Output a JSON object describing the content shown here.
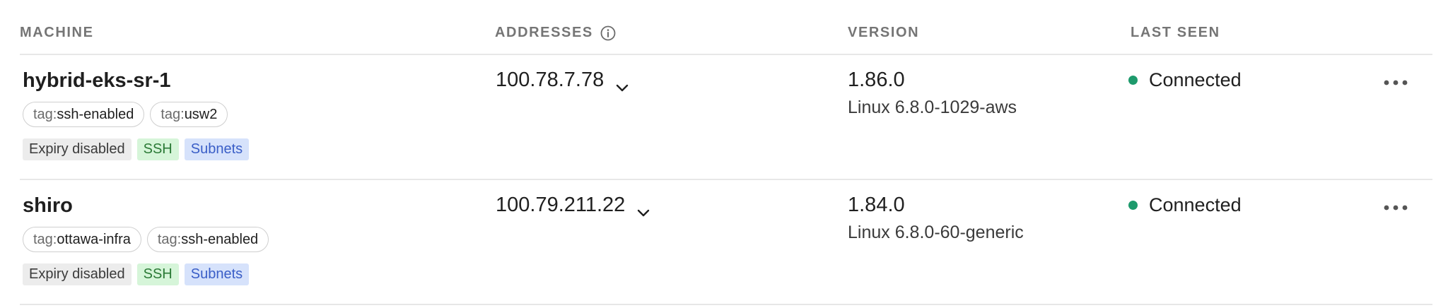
{
  "header": {
    "machine": "MACHINE",
    "addresses": "ADDRESSES",
    "version": "VERSION",
    "last_seen": "LAST SEEN"
  },
  "icons": {
    "info": "info-icon",
    "chevron": "chevron-down-icon",
    "more": "more-horizontal-icon"
  },
  "colors": {
    "connected": "#1d9a6c",
    "ssh_badge_bg": "#d6f5d9",
    "subnets_badge_bg": "#d6e2fb",
    "expiry_badge_bg": "#ececec"
  },
  "machines": [
    {
      "name": "hybrid-eks-sr-1",
      "tags": [
        {
          "prefix": "tag:",
          "value": "ssh-enabled"
        },
        {
          "prefix": "tag:",
          "value": "usw2"
        }
      ],
      "badges": {
        "expiry": "Expiry disabled",
        "ssh": "SSH",
        "subnets": "Subnets"
      },
      "address": "100.78.7.78",
      "version": "1.86.0",
      "os": "Linux 6.8.0-1029-aws",
      "status": "Connected"
    },
    {
      "name": "shiro",
      "tags": [
        {
          "prefix": "tag:",
          "value": "ottawa-infra"
        },
        {
          "prefix": "tag:",
          "value": "ssh-enabled"
        }
      ],
      "badges": {
        "expiry": "Expiry disabled",
        "ssh": "SSH",
        "subnets": "Subnets"
      },
      "address": "100.79.211.22",
      "version": "1.84.0",
      "os": "Linux 6.8.0-60-generic",
      "status": "Connected"
    }
  ]
}
